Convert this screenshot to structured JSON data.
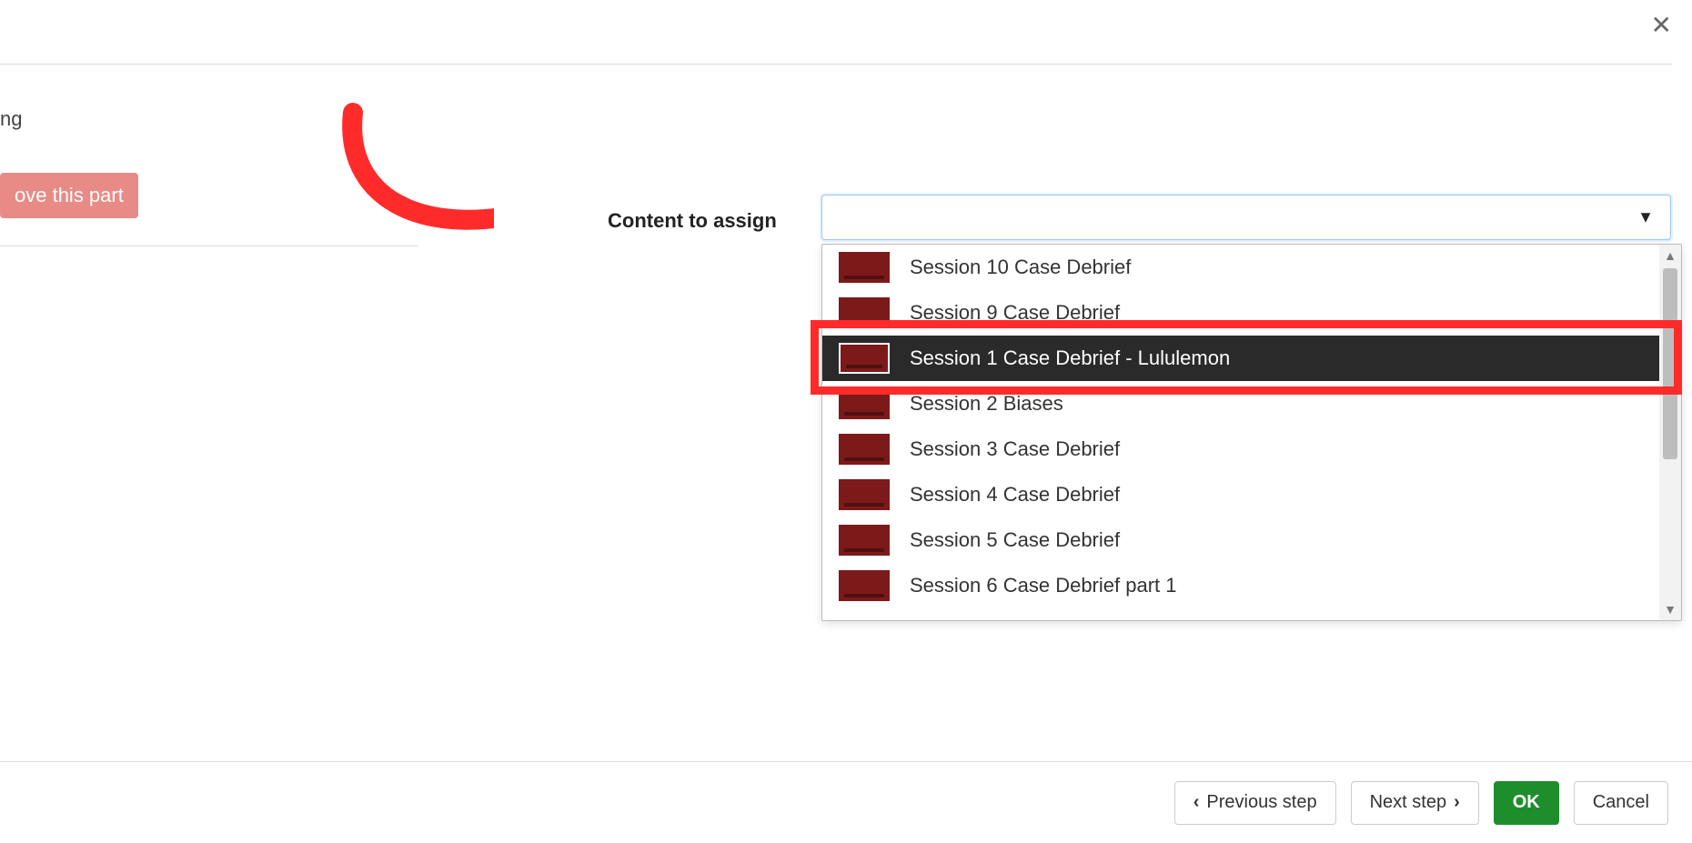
{
  "close_icon": "✕",
  "partial_text": "ng",
  "remove_button_label": "ove this part",
  "field_label": "Content to assign",
  "combo_value": "",
  "dropdown": {
    "selected_index": 2,
    "items": [
      {
        "label": "Session 10 Case Debrief"
      },
      {
        "label": "Session 9 Case Debrief"
      },
      {
        "label": "Session 1 Case Debrief - Lululemon"
      },
      {
        "label": "Session 2 Biases"
      },
      {
        "label": "Session 3 Case Debrief"
      },
      {
        "label": "Session 4 Case Debrief"
      },
      {
        "label": "Session 5 Case Debrief"
      },
      {
        "label": "Session 6 Case Debrief part 1"
      }
    ]
  },
  "footer": {
    "prev_label": "Previous step",
    "next_label": "Next step",
    "ok_label": "OK",
    "cancel_label": "Cancel"
  }
}
